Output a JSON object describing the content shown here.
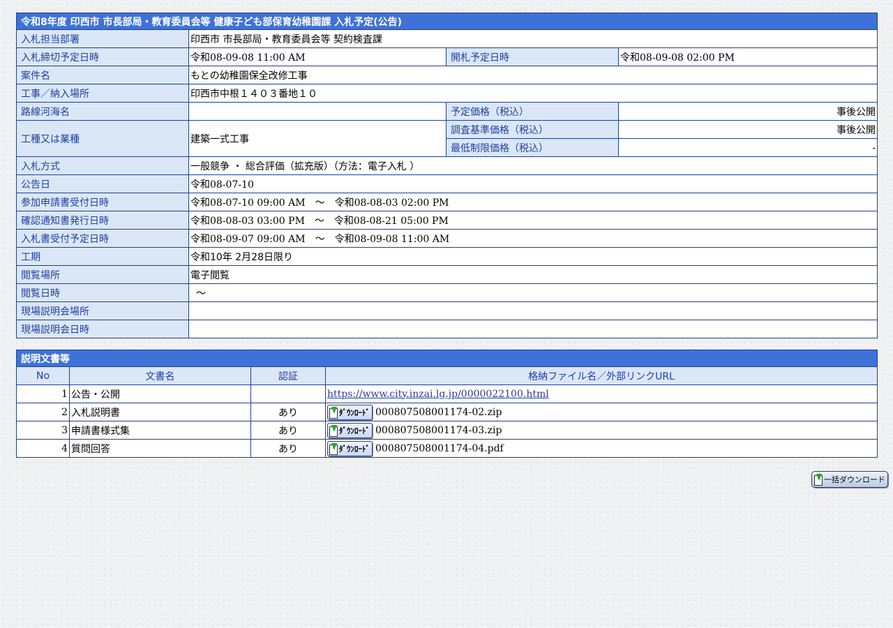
{
  "main_table": {
    "title": "令和8年度 印西市 市長部局・教育委員会等 健康子ども部保育幼稚園課 入札予定(公告)",
    "rows": {
      "dept": {
        "label": "入札担当部署",
        "value": "印西市 市長部局・教育委員会等 契約検査課"
      },
      "deadline": {
        "label": "入札締切予定日時",
        "value": "令和08-09-08 11:00 AM"
      },
      "opening": {
        "label": "開札予定日時",
        "value": "令和08-09-08 02:00 PM"
      },
      "case_name": {
        "label": "案件名",
        "value": "もとの幼稚園保全改修工事"
      },
      "location": {
        "label": "工事／納入場所",
        "value": "印西市中根１４０３番地１０"
      },
      "route": {
        "label": "路線河海名",
        "value": ""
      },
      "planned_price": {
        "label": "予定価格（税込）",
        "value": "事後公開"
      },
      "work_type": {
        "label": "工種又は業種",
        "value": "建築一式工事"
      },
      "survey_price": {
        "label": "調査基準価格（税込）",
        "value": "事後公開"
      },
      "min_price": {
        "label": "最低制限価格（税込）",
        "value": "-"
      },
      "method": {
        "label": "入札方式",
        "value": "一般競争 ・ 総合評価（拡充版）（方法：電子入札 ）"
      },
      "notice_date": {
        "label": "公告日",
        "value": "令和08-07-10"
      },
      "application": {
        "label": "参加申請書受付日時",
        "value": "令和08-07-10 09:00 AM　～　令和08-08-03 02:00 PM"
      },
      "confirm": {
        "label": "確認通知書発行日時",
        "value": "令和08-08-03 03:00 PM　～　令和08-08-21 05:00 PM"
      },
      "bid_receipt": {
        "label": "入札書受付予定日時",
        "value": "令和08-09-07 09:00 AM　～　令和08-09-08 11:00 AM"
      },
      "period": {
        "label": "工期",
        "value": "令和10年 2月28日限り"
      },
      "view_place": {
        "label": "閲覧場所",
        "value": "電子閲覧"
      },
      "view_date": {
        "label": "閲覧日時",
        "value": "～"
      },
      "site_place": {
        "label": "現場説明会場所",
        "value": ""
      },
      "site_date": {
        "label": "現場説明会日時",
        "value": ""
      }
    }
  },
  "docs_table": {
    "title": "説明文書等",
    "headers": {
      "no": "No",
      "name": "文書名",
      "cert": "認証",
      "file": "格納ファイル名／外部リンクURL"
    },
    "rows": [
      {
        "no": "1",
        "name": "公告・公開",
        "cert": "",
        "link": "https://www.city.inzai.lg.jp/0000022100.html"
      },
      {
        "no": "2",
        "name": "入札説明書",
        "cert": "あり",
        "file": "000807508001174-02.zip"
      },
      {
        "no": "3",
        "name": "申請書様式集",
        "cert": "あり",
        "file": "000807508001174-03.zip"
      },
      {
        "no": "4",
        "name": "質問回答",
        "cert": "あり",
        "file": "000807508001174-04.pdf"
      }
    ],
    "download_label": "ﾀﾞｳﾝﾛｰﾄﾞ"
  },
  "bulk_download_label": "一括ダウンロード",
  "icons": {
    "download": "download-icon"
  },
  "colors": {
    "header_bg": "#3f72d9",
    "label_bg": "#dbe7f7",
    "label_text": "#1f3f9f",
    "border": "#1f3f8f"
  }
}
